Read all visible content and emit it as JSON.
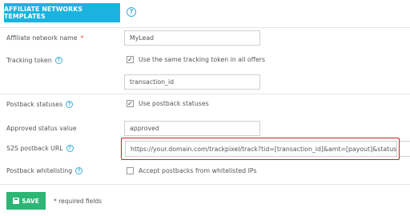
{
  "header": {
    "templates_button_label": "AFFILIATE NETWORKS TEMPLATES",
    "help_glyph": "?"
  },
  "fields": {
    "network_name": {
      "label": "Affiliate network name",
      "required_mark": "*",
      "value": "MyLead"
    },
    "tracking_token": {
      "label": "Tracking token",
      "checkbox_label": "Use the same tracking token in all offers",
      "checked": true,
      "value": "transaction_id"
    },
    "postback_statuses": {
      "label": "Postback statuses",
      "checkbox_label": "Use postback statuses",
      "checked": true
    },
    "approved_status": {
      "label": "Approved status value",
      "value": "approved"
    },
    "s2s_postback_url": {
      "label": "S2S postback URL",
      "value": "https://your.domain.com/trackpixel/track?tid=[transaction_id]&amt=[payout]&status=[status]"
    },
    "postback_whitelisting": {
      "label": "Postback whitelisting",
      "checkbox_label": "Accept postbacks from whitelisted IPs",
      "checked": false
    }
  },
  "footer": {
    "save_label": "SAVE",
    "required_note": "* required fields"
  },
  "icons": {
    "help": "help-circle-icon",
    "check": "checkmark-icon",
    "save": "floppy-disk-icon"
  },
  "colors": {
    "primary": "#1ab3e0",
    "success": "#2bb673",
    "highlight": "#c0222b",
    "required": "#e74c3c"
  }
}
